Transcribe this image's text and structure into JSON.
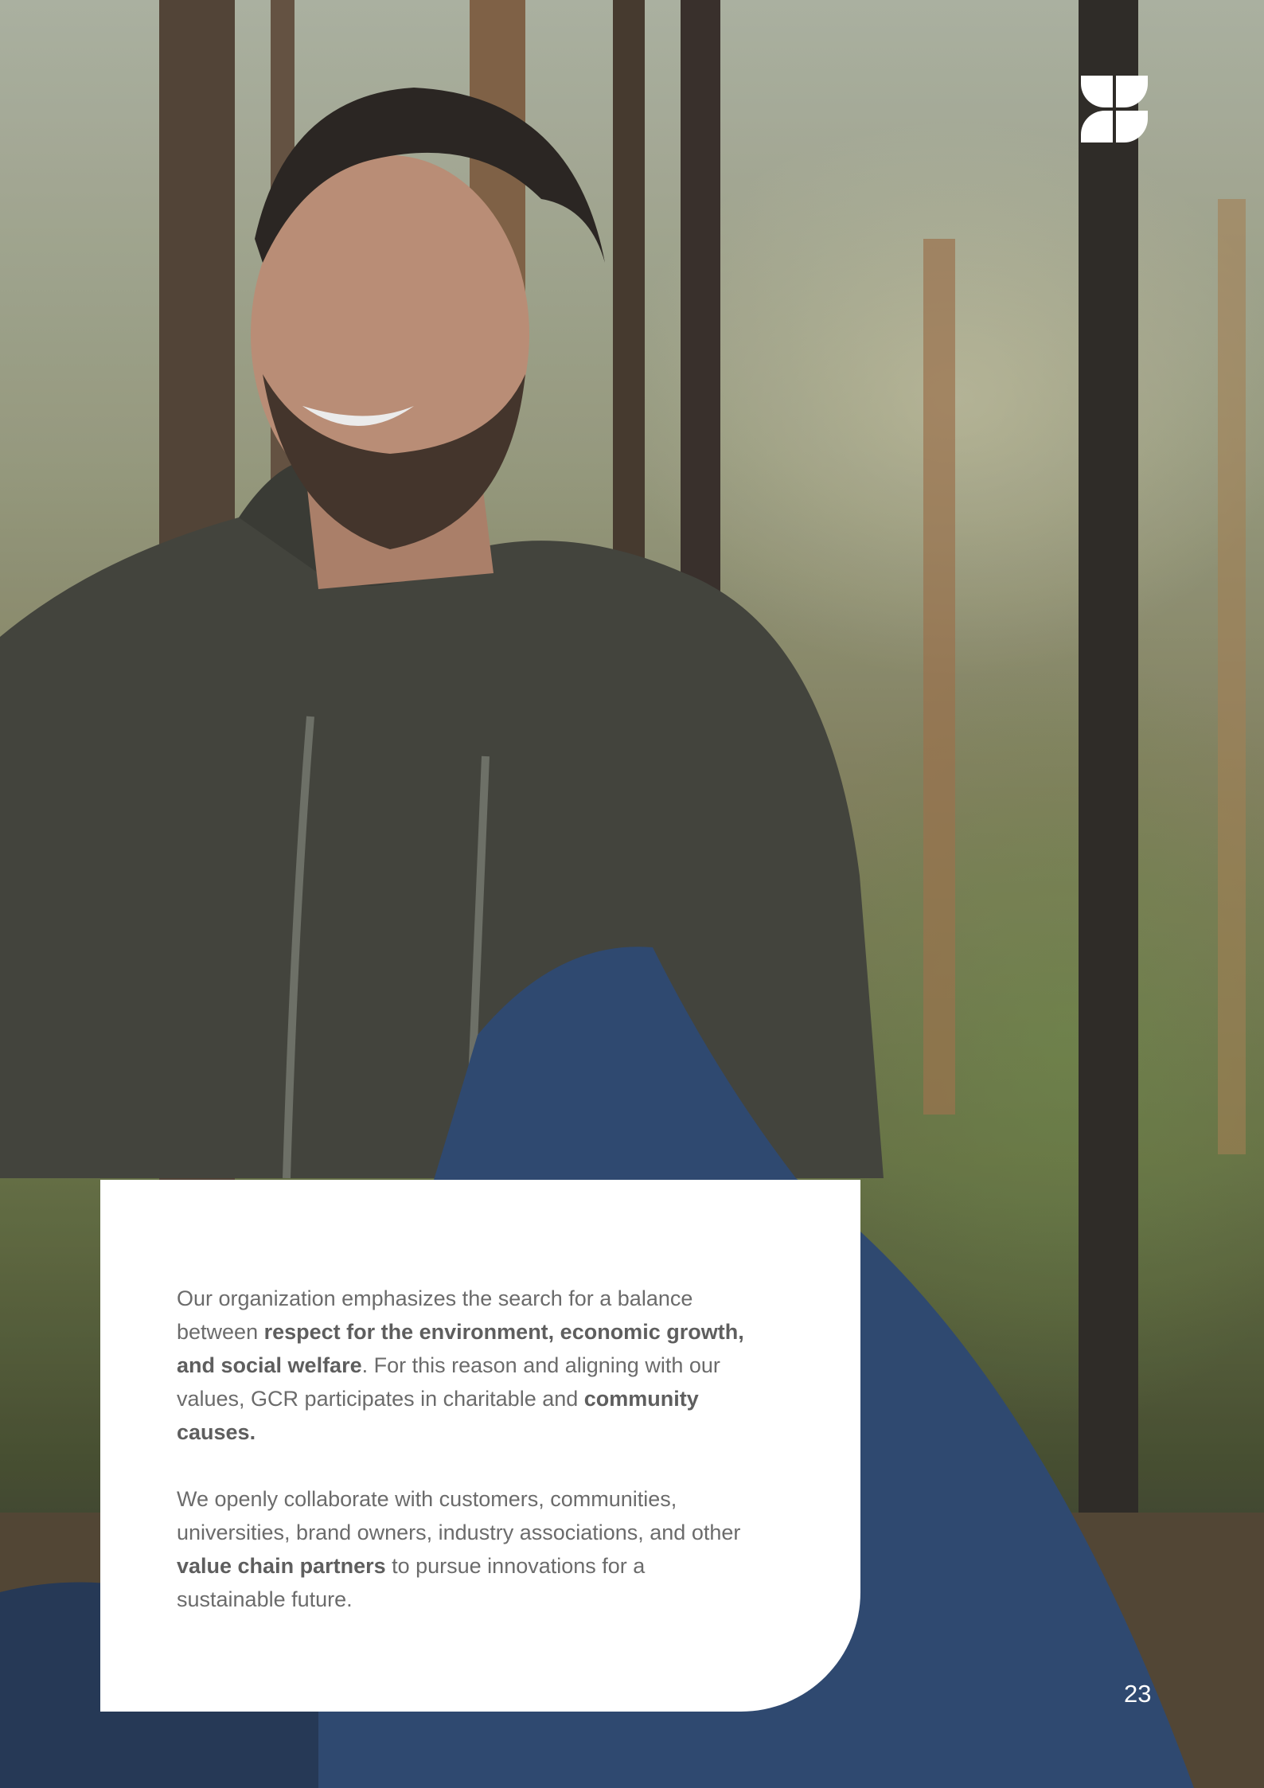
{
  "photo": {
    "subject": "smiling young man with beard in dark hoodie holding a blue tent in a forest"
  },
  "logo": {
    "icon": "four-leaf-brand-icon",
    "color": "#ffffff"
  },
  "card": {
    "paragraph1": {
      "part1": "Our organization emphasizes the search for a balance between ",
      "bold1": "respect for the environment, economic growth, and social welfare",
      "part2": ". For this reason and aligning with our values, GCR participates in charitable and ",
      "bold2": "community causes."
    },
    "paragraph2": {
      "part1": "We openly collaborate with customers, communities, universities, brand owners, industry associations, and other ",
      "bold1": "value chain partners",
      "part2": " to pursue innovations for a sustainable future."
    }
  },
  "page_number": "23"
}
